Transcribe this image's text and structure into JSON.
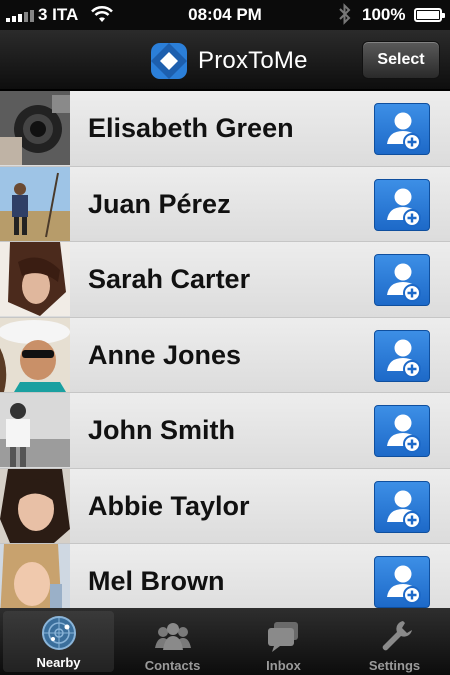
{
  "status_bar": {
    "carrier": "3 ITA",
    "time": "08:04 PM",
    "battery_text": "100%",
    "battery_level": 1.0
  },
  "nav": {
    "app_title": "ProxToMe",
    "select_label": "Select"
  },
  "contacts": [
    {
      "name": "Elisabeth Green"
    },
    {
      "name": "Juan Pérez"
    },
    {
      "name": "Sarah Carter"
    },
    {
      "name": "Anne Jones"
    },
    {
      "name": "John Smith"
    },
    {
      "name": "Abbie Taylor"
    },
    {
      "name": "Mel Brown"
    }
  ],
  "tabs": [
    {
      "label": "Nearby",
      "icon": "radar-icon",
      "active": true
    },
    {
      "label": "Contacts",
      "icon": "people-icon",
      "active": false
    },
    {
      "label": "Inbox",
      "icon": "chat-bubbles-icon",
      "active": false
    },
    {
      "label": "Settings",
      "icon": "wrench-icon",
      "active": false
    }
  ],
  "colors": {
    "accent": "#2a7ad8",
    "logo_blue": "#2b7fd9"
  }
}
